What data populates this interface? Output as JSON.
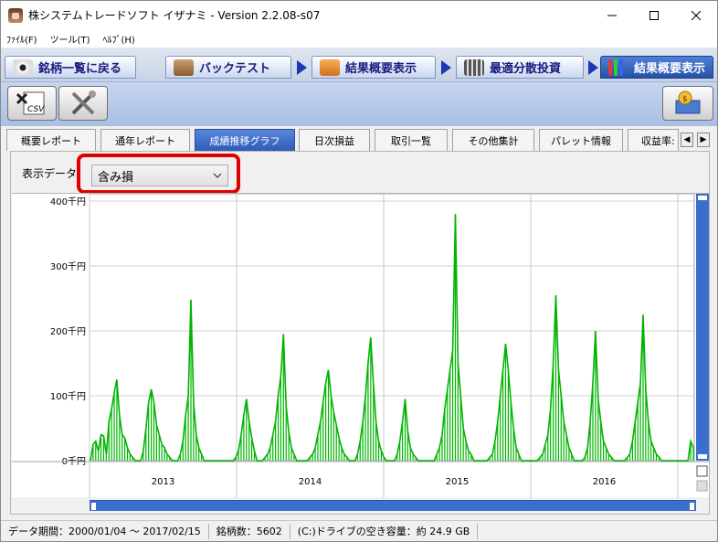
{
  "window": {
    "title": "株システムトレードソフト イザナミ - Version 2.2.08-s07"
  },
  "menu": [
    "ﾌｧｲﾙ(F)",
    "ツール(T)",
    "ﾍﾙﾌﾟ(H)"
  ],
  "steps": [
    {
      "label": "銘柄一覧に戻る",
      "icon": "eye-icon"
    },
    {
      "label": "バックテスト",
      "icon": "bag-icon"
    },
    {
      "label": "結果概要表示",
      "icon": "hand-chart-icon"
    },
    {
      "label": "最適分散投資",
      "icon": "calculator-icon"
    },
    {
      "label": "結果概要表示",
      "icon": "bar-chart-icon"
    }
  ],
  "toolbar": {
    "csv_label": "CSV",
    "buttons": [
      "csv-export-icon",
      "tools-icon",
      "money-box-icon"
    ]
  },
  "tabs": [
    "概要レポート",
    "通年レポート",
    "成績推移グラフ",
    "日次損益",
    "取引一覧",
    "その他集計",
    "パレット情報",
    "収益率:"
  ],
  "active_tab": 2,
  "filter": {
    "label": "表示データ",
    "selected": "含み損"
  },
  "colors": {
    "series": "#00b400",
    "highlight": "#e00000",
    "accent": "#2e5cb8"
  },
  "chart_data": {
    "type": "bar",
    "ylabel": "",
    "ylim": [
      0,
      400
    ],
    "y_ticks": [
      "400千円",
      "300千円",
      "200千円",
      "100千円",
      "0千円"
    ],
    "x_ticks": [
      "2013",
      "2014",
      "2015",
      "2016"
    ],
    "grid": true,
    "series": [
      {
        "values": [
          0,
          25,
          30,
          15,
          40,
          38,
          10,
          60,
          80,
          105,
          125,
          70,
          40,
          35,
          20,
          10,
          5,
          0,
          0,
          0,
          15,
          50,
          90,
          110,
          90,
          55,
          40,
          25,
          20,
          10,
          5,
          0,
          0,
          0,
          10,
          30,
          70,
          100,
          248,
          90,
          40,
          20,
          10,
          0,
          0,
          0,
          0,
          0,
          0,
          0,
          0,
          0,
          0,
          0,
          0,
          5,
          15,
          40,
          70,
          95,
          60,
          35,
          15,
          0,
          0,
          0,
          5,
          10,
          20,
          40,
          60,
          100,
          130,
          195,
          85,
          45,
          20,
          10,
          0,
          0,
          0,
          0,
          0,
          5,
          10,
          20,
          40,
          60,
          90,
          120,
          140,
          100,
          75,
          55,
          35,
          20,
          10,
          5,
          0,
          0,
          0,
          10,
          30,
          60,
          100,
          150,
          190,
          120,
          60,
          30,
          15,
          5,
          0,
          0,
          0,
          0,
          10,
          30,
          60,
          95,
          45,
          20,
          10,
          5,
          0,
          0,
          0,
          0,
          0,
          0,
          0,
          10,
          20,
          40,
          80,
          110,
          140,
          170,
          380,
          150,
          100,
          50,
          30,
          15,
          10,
          0,
          0,
          0,
          0,
          0,
          0,
          5,
          10,
          30,
          60,
          100,
          140,
          180,
          140,
          90,
          50,
          20,
          10,
          0,
          0,
          0,
          0,
          0,
          0,
          0,
          5,
          10,
          25,
          40,
          80,
          150,
          255,
          140,
          100,
          60,
          40,
          20,
          10,
          0,
          0,
          0,
          0,
          5,
          20,
          60,
          120,
          200,
          95,
          60,
          30,
          20,
          10,
          5,
          0,
          0,
          0,
          0,
          0,
          5,
          10,
          30,
          60,
          90,
          120,
          225,
          110,
          60,
          30,
          20,
          10,
          5,
          0,
          0,
          0,
          0,
          0,
          0,
          0,
          0,
          0,
          0,
          0,
          30,
          20
        ]
      }
    ]
  },
  "status": {
    "period": "データ期間：2000/01/04 〜 2017/02/15",
    "stocks": "銘柄数：5602",
    "disk": "(C:)ドライブの空き容量：約 24.9 GB"
  }
}
